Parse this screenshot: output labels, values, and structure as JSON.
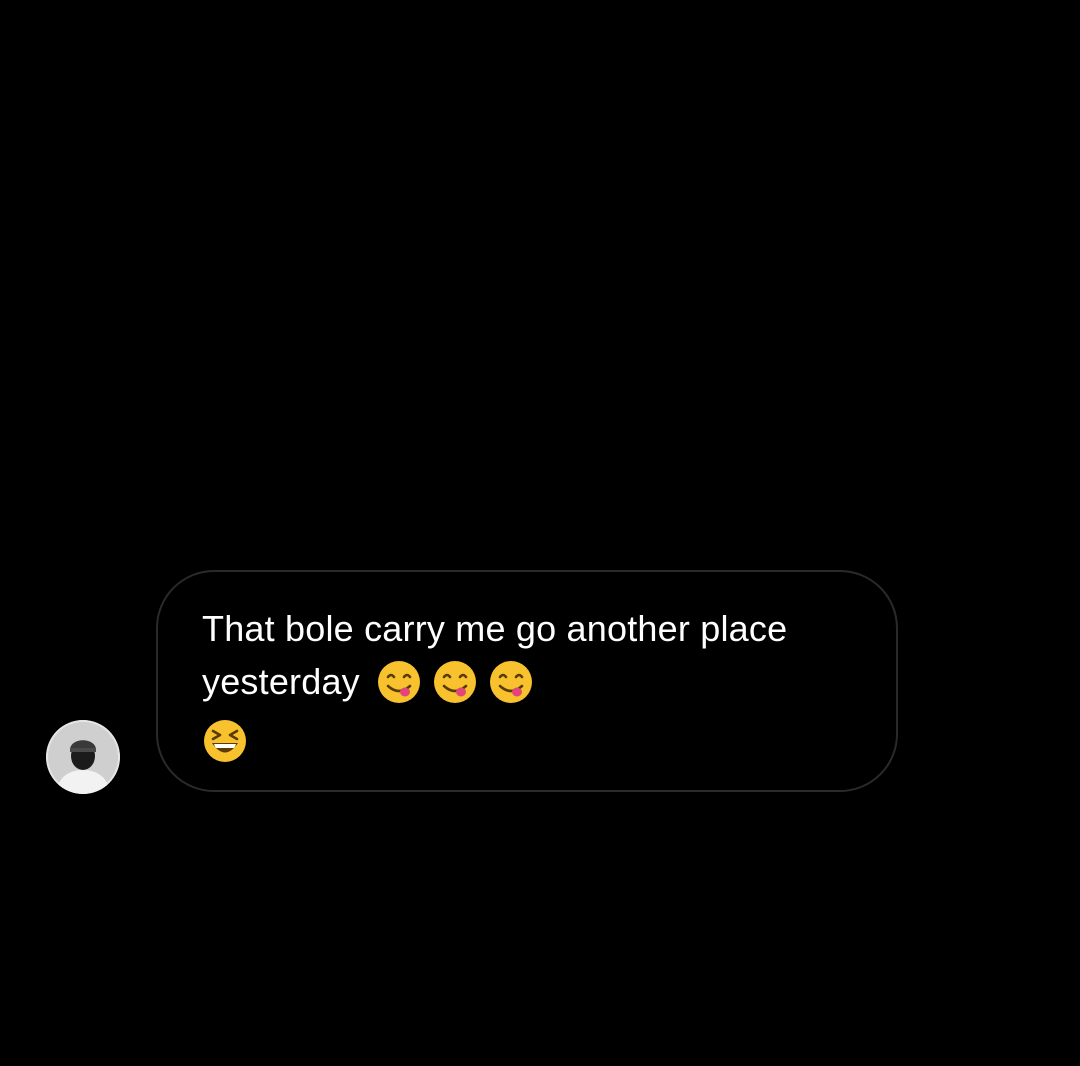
{
  "conversation": {
    "message": {
      "line1": "That bole carry me go another place",
      "line2": "yesterday",
      "line2_emojis": [
        "face-savoring-food-icon",
        "face-savoring-food-icon",
        "face-savoring-food-icon"
      ],
      "line3_emojis": [
        "grinning-squinting-face-icon"
      ]
    },
    "sender_avatar": "user-avatar-photo"
  },
  "colors": {
    "background": "#000000",
    "bubble_border": "#2a2a2a",
    "text": "#ffffff",
    "emoji_yellow": "#f7c22e"
  }
}
